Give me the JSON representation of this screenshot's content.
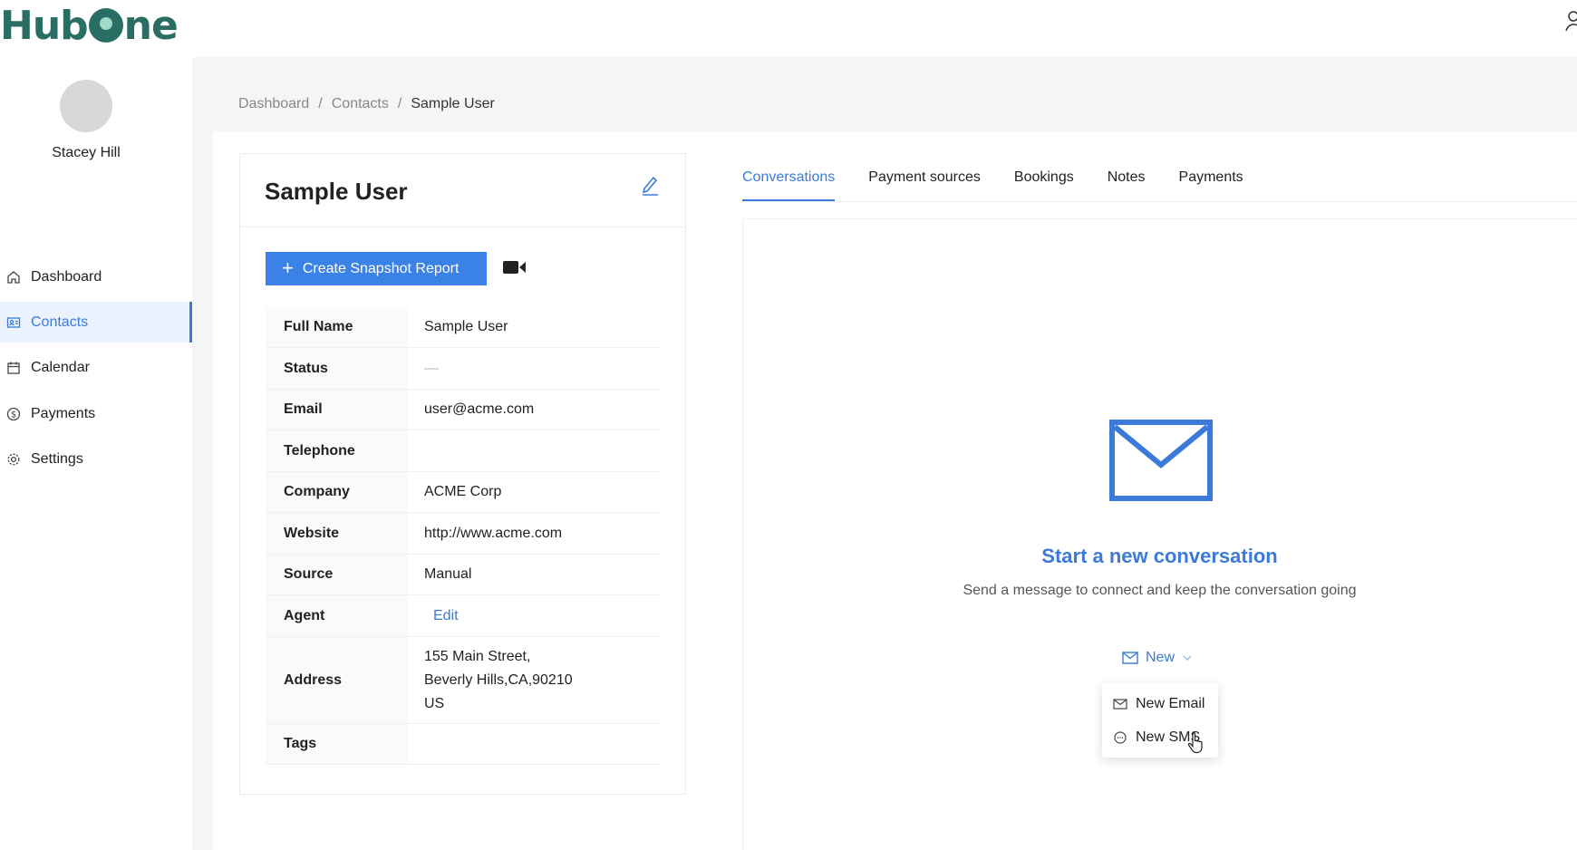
{
  "app": {
    "brand_name": "HubOne",
    "brand_color": "#2a6e63",
    "accent": "#3b7ad9"
  },
  "sidebar": {
    "user_name": "Stacey Hill",
    "items": [
      {
        "label": "Dashboard",
        "icon": "home-icon",
        "active": false
      },
      {
        "label": "Contacts",
        "icon": "contacts-icon",
        "active": true
      },
      {
        "label": "Calendar",
        "icon": "calendar-icon",
        "active": false
      },
      {
        "label": "Payments",
        "icon": "dollar-circle-icon",
        "active": false
      },
      {
        "label": "Settings",
        "icon": "gear-icon",
        "active": false
      }
    ]
  },
  "breadcrumb": {
    "items": [
      "Dashboard",
      "Contacts",
      "Sample User"
    ],
    "separator": "/"
  },
  "contact": {
    "title": "Sample User",
    "snapshot_button": "Create Snapshot Report",
    "fields": [
      {
        "key": "Full Name",
        "value": "Sample User"
      },
      {
        "key": "Status",
        "value": "—"
      },
      {
        "key": "Email",
        "value": "user@acme.com"
      },
      {
        "key": "Telephone",
        "value": ""
      },
      {
        "key": "Company",
        "value": "ACME Corp"
      },
      {
        "key": "Website",
        "value": "http://www.acme.com"
      },
      {
        "key": "Source",
        "value": "Manual"
      },
      {
        "key": "Agent",
        "value": "Edit"
      },
      {
        "key": "Address",
        "lines": [
          "155 Main Street,",
          "Beverly Hills,CA,90210",
          "US"
        ]
      },
      {
        "key": "Tags",
        "value": ""
      }
    ]
  },
  "tabs": [
    {
      "label": "Conversations",
      "active": true
    },
    {
      "label": "Payment sources",
      "active": false
    },
    {
      "label": "Bookings",
      "active": false
    },
    {
      "label": "Notes",
      "active": false
    },
    {
      "label": "Payments",
      "active": false
    }
  ],
  "conversation": {
    "title": "Start a new conversation",
    "subtitle": "Send a message to connect and keep the conversation going",
    "new_label": "New",
    "menu": [
      "New Email",
      "New SMS"
    ]
  }
}
